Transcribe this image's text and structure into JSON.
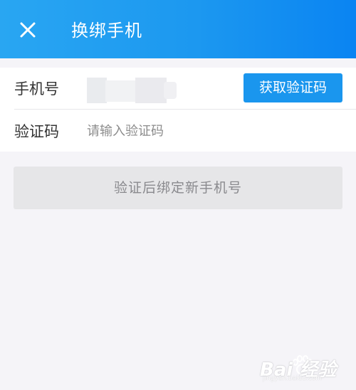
{
  "header": {
    "title": "换绑手机",
    "close_icon": "close-icon"
  },
  "form": {
    "phone_label": "手机号",
    "get_code_label": "获取验证码",
    "code_label": "验证码",
    "code_placeholder": "请输入验证码",
    "code_value": ""
  },
  "submit_label": "验证后绑定新手机号",
  "watermark": {
    "text": "Bai 经验",
    "sub": "jingyan.baidu.com"
  },
  "colors": {
    "header": "#1c98f0",
    "accent_button": "#1a96ee",
    "disabled_button": "#e6e6e8",
    "background": "#f5f4f8"
  }
}
